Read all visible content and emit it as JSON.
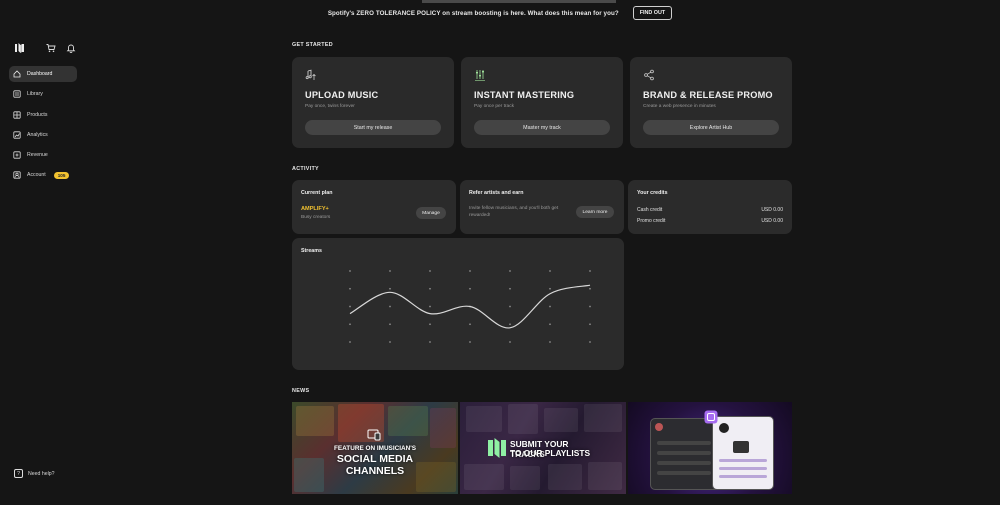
{
  "banner": {
    "text": "Spotify's ZERO TOLERANCE POLICY on stream boosting is here. What does this mean for you?",
    "button": "FIND OUT"
  },
  "sidebar": {
    "icons": [
      "logo-icon",
      "cart-icon",
      "bell-icon"
    ],
    "items": [
      {
        "label": "Dashboard",
        "icon": "home-icon",
        "active": true
      },
      {
        "label": "Library",
        "icon": "library-icon"
      },
      {
        "label": "Products",
        "icon": "products-icon"
      },
      {
        "label": "Analytics",
        "icon": "analytics-icon"
      },
      {
        "label": "Revenue",
        "icon": "revenue-icon"
      },
      {
        "label": "Account",
        "icon": "account-icon",
        "badge": "105"
      }
    ],
    "help": "Need help?"
  },
  "get_started": {
    "title": "GET STARTED",
    "cards": [
      {
        "icon": "upload-music-icon",
        "title": "UPLOAD MUSIC",
        "subtitle": "Pay once, twins forever",
        "button": "Start my release"
      },
      {
        "icon": "mastering-icon",
        "title": "INSTANT MASTERING",
        "subtitle": "Pay once per track",
        "button": "Master my track"
      },
      {
        "icon": "share-icon",
        "title": "BRAND & RELEASE PROMO",
        "subtitle": "Create a web presence in minutes",
        "button": "Explore Artist Hub"
      }
    ]
  },
  "activity": {
    "title": "ACTIVITY",
    "plan": {
      "title": "Current plan",
      "name": "AMPLIFY+",
      "subtitle": "Busy creators",
      "button": "Manage"
    },
    "refer": {
      "title": "Refer artists and earn",
      "desc": "Invite fellow musicians, and you'll both get rewarded!",
      "button": "Learn more"
    },
    "credits": {
      "title": "Your credits",
      "rows": [
        {
          "label": "Cash credit",
          "value": "USD 0.00"
        },
        {
          "label": "Promo credit",
          "value": "USD 0.00"
        }
      ]
    },
    "streams": {
      "title": "Streams"
    }
  },
  "chart_data": {
    "type": "line",
    "title": "Streams",
    "x": [
      0,
      1,
      2,
      3,
      4,
      5,
      6
    ],
    "series": [
      {
        "values": [
          1.0,
          2.5,
          1.0,
          1.5,
          0.0,
          2.4,
          3.0
        ]
      }
    ],
    "ylim": [
      -1.0,
      4.0
    ],
    "grid": "dots",
    "line_color": "#d8d8d8"
  },
  "news": {
    "title": "NEWS",
    "items": [
      {
        "line1": "FEATURE ON IMUSICIAN'S",
        "line2": "SOCIAL MEDIA",
        "line3": "CHANNELS"
      },
      {
        "line1": "SUBMIT YOUR TRACKS",
        "line2": "TO OUR PLAYLISTS"
      },
      {
        "icon": "app-mockup-icon"
      }
    ]
  }
}
